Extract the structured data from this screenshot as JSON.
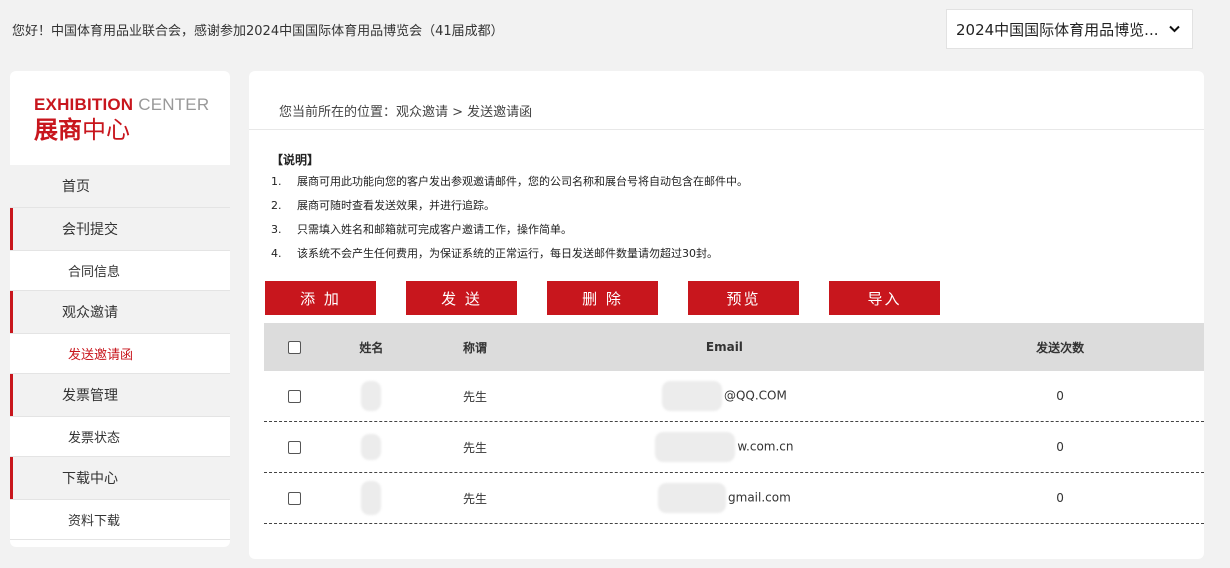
{
  "header": {
    "greeting": "您好！中国体育用品业联合会，感谢参加2024中国国际体育用品博览会（41届成都）",
    "exhibition_select": "2024中国国际体育用品博览..."
  },
  "logo": {
    "en_bold": "EXHIBITION",
    "en_rest": " CENTER",
    "cn_bold": "展商",
    "cn_rest": "中心"
  },
  "sidebar": {
    "items": [
      {
        "label": "首页",
        "type": "top"
      },
      {
        "label": "会刊提交",
        "type": "group"
      },
      {
        "label": "合同信息",
        "type": "sub"
      },
      {
        "label": "观众邀请",
        "type": "group"
      },
      {
        "label": "发送邀请函",
        "type": "sub",
        "active": true
      },
      {
        "label": "发票管理",
        "type": "group"
      },
      {
        "label": "发票状态",
        "type": "sub"
      },
      {
        "label": "下载中心",
        "type": "group"
      },
      {
        "label": "资料下载",
        "type": "sub"
      }
    ]
  },
  "main": {
    "breadcrumb": "您当前所在的位置：观众邀请 > 发送邀请函",
    "notes_title": "【说明】",
    "notes": [
      {
        "num": "1.",
        "text": "展商可用此功能向您的客户发出参观邀请邮件，您的公司名称和展台号将自动包含在邮件中。"
      },
      {
        "num": "2.",
        "text": "展商可随时查看发送效果，并进行追踪。"
      },
      {
        "num": "3.",
        "text": "只需填入姓名和邮箱就可完成客户邀请工作，操作简单。"
      },
      {
        "num": "4.",
        "text": "该系统不会产生任何费用，为保证系统的正常运行，每日发送邮件数量请勿超过30封。"
      }
    ],
    "buttons": {
      "add": "添 加",
      "send": "发 送",
      "delete": "删 除",
      "preview": "预览",
      "import": "导入"
    },
    "table": {
      "headers": {
        "name": "姓名",
        "title": "称谓",
        "email": "Email",
        "count": "发送次数"
      },
      "rows": [
        {
          "title": "先生",
          "email": "@QQ.COM",
          "count": "0"
        },
        {
          "title": "先生",
          "email": "w.com.cn",
          "count": "0"
        },
        {
          "title": "先生",
          "email": "gmail.com",
          "count": "0"
        }
      ]
    }
  },
  "colors": {
    "accent": "#c8161d",
    "bg": "#f2f2f2"
  }
}
